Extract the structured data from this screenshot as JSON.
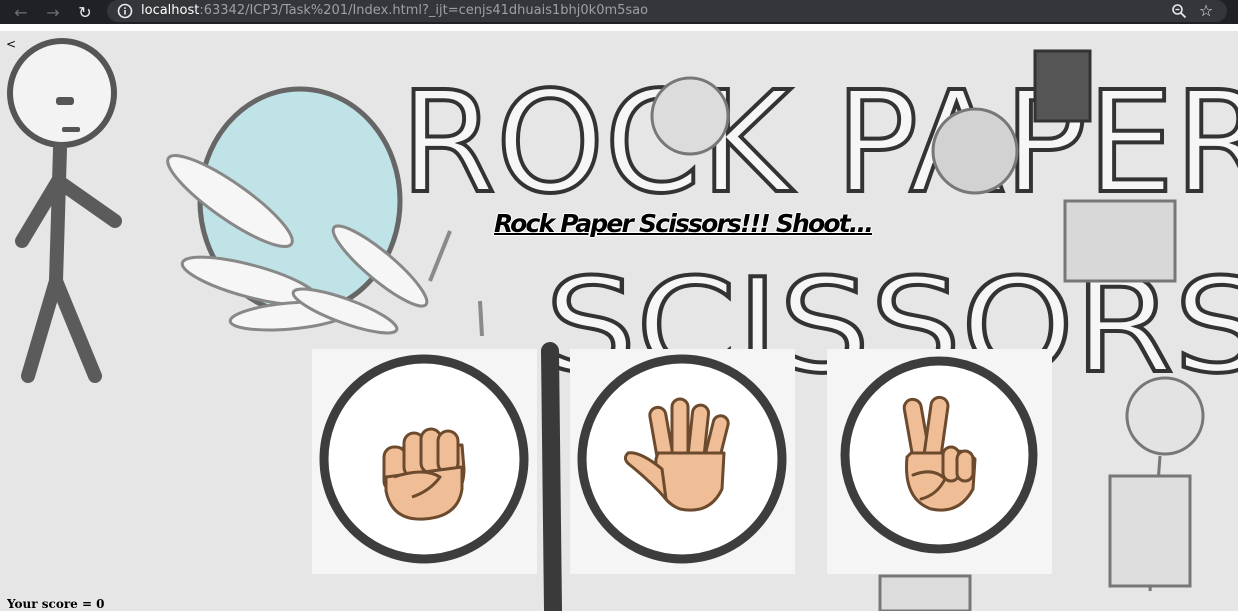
{
  "browser": {
    "url_host": "localhost",
    "url_rest": ":63342/ICP3/Task%201/Index.html?_ijt=cenjs41dhuais1bhj0k0m5sao"
  },
  "page": {
    "back_link": "<",
    "tagline": "Rock Paper Scissors!!! Shoot...",
    "background_banner": [
      "ROCK PAPER",
      "SCISSORS"
    ],
    "choices": [
      {
        "id": "rock",
        "icon": "rock-fist-icon"
      },
      {
        "id": "paper",
        "icon": "paper-open-hand-icon"
      },
      {
        "id": "scissors",
        "icon": "scissors-peace-hand-icon"
      }
    ],
    "score_label": "Your score = 0"
  },
  "colors": {
    "chrome": "#202124",
    "omnibox": "#35363a",
    "skin": "#F0BE96",
    "ring": "#3d3d3d"
  }
}
